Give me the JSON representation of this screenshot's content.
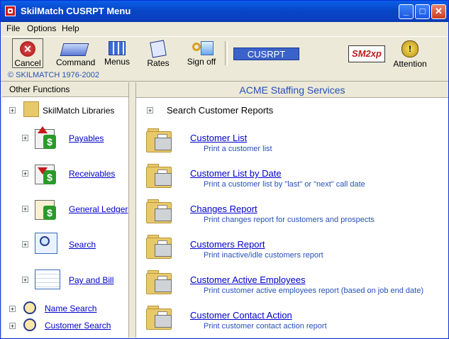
{
  "window": {
    "title": "SkilMatch CUSRPT Menu"
  },
  "menu": [
    "File",
    "Options",
    "Help"
  ],
  "toolbar": {
    "cancel": "Cancel",
    "command": "Command",
    "menus": "Menus",
    "rates": "Rates",
    "signoff": "Sign off",
    "screen_id": "CUSRPT",
    "logo": "SM2xp",
    "attention": "Attention"
  },
  "copyright": "© SKILMATCH 1976-2002",
  "left": {
    "header": "Other Functions",
    "libraries": "SkilMatch Libraries",
    "items": [
      "Payables",
      "Receivables",
      "General Ledger",
      "Search",
      "Pay and Bill"
    ],
    "name_search": "Name Search",
    "customer_search": "Customer Search"
  },
  "right": {
    "header": "ACME Staffing Services",
    "section": "Search Customer Reports",
    "reports": [
      {
        "title": "Customer List",
        "desc": "Print a customer list"
      },
      {
        "title": "Customer List by Date",
        "desc": "Print a customer list by \"last\" or \"next\" call date"
      },
      {
        "title": "Changes Report",
        "desc": "Print changes report for customers and prospects"
      },
      {
        "title": "Customers Report",
        "desc": "Print inactive/idle customers report"
      },
      {
        "title": "Customer Active Employees",
        "desc": "Print customer active employees report (based on job end date)"
      },
      {
        "title": "Customer Contact Action",
        "desc": "Print customer contact action report"
      }
    ]
  }
}
